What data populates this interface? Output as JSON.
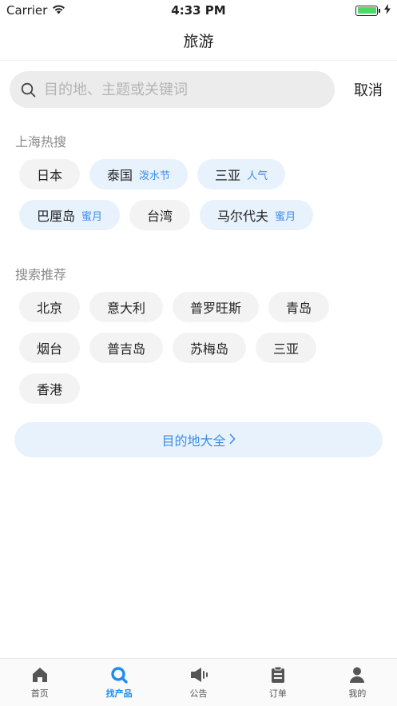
{
  "status_bar": {
    "carrier": "Carrier",
    "time": "4:33 PM"
  },
  "nav": {
    "title": "旅游"
  },
  "search": {
    "placeholder": "目的地、主题或关键词",
    "cancel_label": "取消"
  },
  "hot_search": {
    "title": "上海热搜",
    "items": [
      {
        "label": "日本",
        "tag": ""
      },
      {
        "label": "泰国",
        "tag": "泼水节"
      },
      {
        "label": "三亚",
        "tag": "人气"
      },
      {
        "label": "巴厘岛",
        "tag": "蜜月"
      },
      {
        "label": "台湾",
        "tag": ""
      },
      {
        "label": "马尔代夫",
        "tag": "蜜月"
      }
    ]
  },
  "recommend": {
    "title": "搜索推荐",
    "items": [
      "北京",
      "意大利",
      "普罗旺斯",
      "青岛",
      "烟台",
      "普吉岛",
      "苏梅岛",
      "三亚",
      "香港"
    ]
  },
  "all_destinations": {
    "label": "目的地大全"
  },
  "tabs": [
    {
      "label": "首页",
      "icon": "home-icon"
    },
    {
      "label": "找产品",
      "icon": "search-icon"
    },
    {
      "label": "公告",
      "icon": "megaphone-icon"
    },
    {
      "label": "订单",
      "icon": "clipboard-icon"
    },
    {
      "label": "我的",
      "icon": "person-icon"
    }
  ],
  "colors": {
    "accent": "#1d8cf0",
    "tag": "#3b8ee8",
    "hot_chip_bg": "#e8f2fd",
    "chip_bg": "#f3f3f3"
  }
}
